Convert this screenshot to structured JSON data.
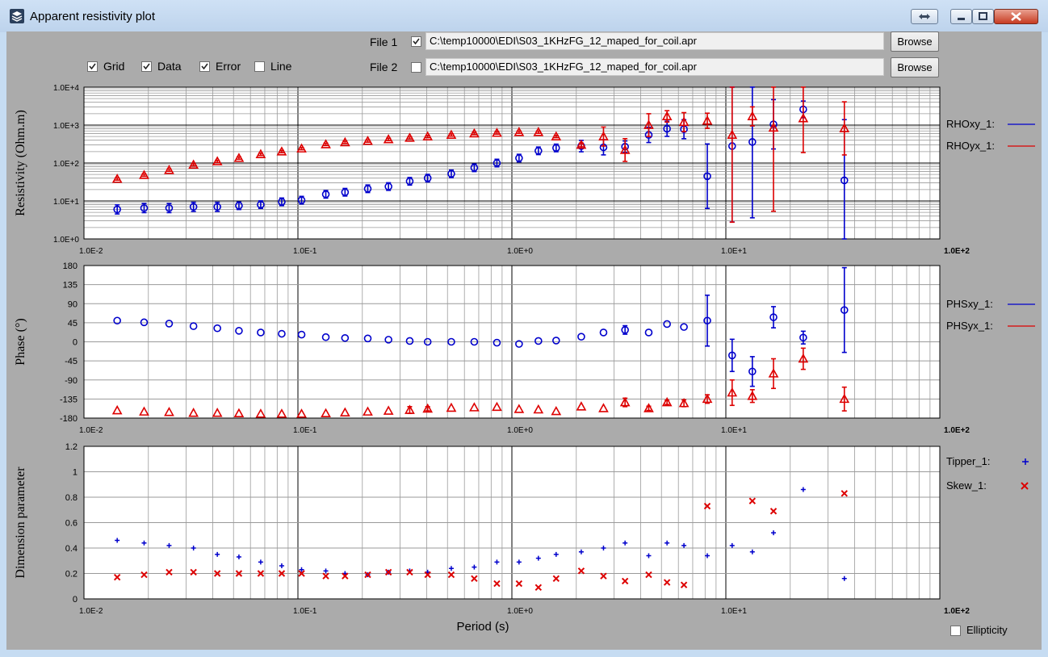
{
  "window": {
    "title": "Apparent resistivity plot",
    "icon": "layers-app-icon",
    "buttons": [
      "swap-icon",
      "minimize-icon",
      "maximize-icon",
      "close-icon"
    ]
  },
  "files": [
    {
      "label": "File 1",
      "checked": true,
      "path": "C:\\temp10000\\EDI\\S03_1KHzFG_12_maped_for_coil.apr",
      "browse": "Browse"
    },
    {
      "label": "File 2",
      "checked": false,
      "path": "C:\\temp10000\\EDI\\S03_1KHzFG_12_maped_for_coil.apr",
      "browse": "Browse"
    }
  ],
  "options": [
    {
      "label": "Grid",
      "checked": true
    },
    {
      "label": "Data",
      "checked": true
    },
    {
      "label": "Error",
      "checked": true
    },
    {
      "label": "Line",
      "checked": false
    }
  ],
  "ellipticity": {
    "label": "Ellipticity",
    "checked": false
  },
  "colors": {
    "blue": "#0000cc",
    "red": "#dd0000",
    "plot_bg": "#ffffff",
    "panel_bg": "#ababab",
    "grid": "#9a9a9a"
  },
  "chart_data": [
    {
      "type": "scatter",
      "ylabel": "Resistivity (Ohm.m)",
      "xlabel": "",
      "x_scale": "log",
      "y_scale": "log",
      "xlim": [
        0.01,
        100
      ],
      "ylim": [
        1,
        10000
      ],
      "xtick_labels": [
        "1.0E-2",
        "1.0E-1",
        "1.0E+0",
        "1.0E+1",
        "1.0E+2"
      ],
      "ytick_labels": [
        "1.0E+0",
        "1.0E+1",
        "1.0E+2",
        "1.0E+3",
        "1.0E+4"
      ],
      "grid": true,
      "legend_position": "right",
      "series": [
        {
          "name": "RHOxy_1:",
          "marker": "circle",
          "color": "#0000cc",
          "x": [
            0.0143,
            0.0191,
            0.025,
            0.0325,
            0.042,
            0.053,
            0.067,
            0.084,
            0.104,
            0.135,
            0.166,
            0.212,
            0.265,
            0.333,
            0.404,
            0.521,
            0.667,
            0.851,
            1.08,
            1.33,
            1.61,
            2.11,
            2.68,
            3.38,
            4.36,
            5.31,
            6.37,
            8.19,
            10.7,
            13.3,
            16.7,
            23.0,
            35.8
          ],
          "y": [
            6,
            6.5,
            6.5,
            7,
            7,
            7.5,
            8,
            9.5,
            10.5,
            15,
            17,
            21,
            24,
            33,
            40,
            52,
            75,
            100,
            135,
            210,
            250,
            280,
            260,
            270,
            550,
            800,
            780,
            45,
            280,
            360,
            1050,
            2600,
            35
          ],
          "err": [
            0.12,
            0.12,
            0.12,
            0.12,
            0.12,
            0.1,
            0.1,
            0.1,
            0.1,
            0.1,
            0.1,
            0.1,
            0.1,
            0.1,
            0.1,
            0.1,
            0.1,
            0.1,
            0.1,
            0.1,
            0.1,
            0.15,
            0.2,
            0.15,
            0.2,
            0.2,
            0.25,
            0.85,
            2.0,
            2.0,
            0.65,
            0.22,
            1.6
          ]
        },
        {
          "name": "RHOyx_1:",
          "marker": "triangle",
          "color": "#dd0000",
          "x": [
            0.0143,
            0.0191,
            0.025,
            0.0325,
            0.042,
            0.053,
            0.067,
            0.084,
            0.104,
            0.135,
            0.166,
            0.212,
            0.265,
            0.333,
            0.404,
            0.521,
            0.667,
            0.851,
            1.08,
            1.33,
            1.61,
            2.11,
            2.68,
            3.38,
            4.36,
            5.31,
            6.37,
            8.19,
            10.7,
            13.3,
            16.7,
            23.0,
            35.8
          ],
          "y": [
            38,
            48,
            65,
            90,
            110,
            135,
            170,
            200,
            240,
            310,
            350,
            380,
            420,
            460,
            500,
            550,
            600,
            620,
            650,
            650,
            500,
            300,
            500,
            220,
            1000,
            1700,
            1200,
            1300,
            550,
            1700,
            850,
            1500,
            820
          ],
          "err": [
            0.03,
            0.03,
            0.03,
            0.03,
            0.03,
            0.03,
            0.03,
            0.03,
            0.03,
            0.03,
            0.03,
            0.03,
            0.03,
            0.03,
            0.03,
            0.03,
            0.03,
            0.03,
            0.03,
            0.03,
            0.03,
            0.05,
            0.25,
            0.3,
            0.3,
            0.15,
            0.25,
            0.2,
            2.3,
            0.25,
            2.2,
            0.9,
            0.7
          ]
        }
      ]
    },
    {
      "type": "scatter",
      "ylabel": "Phase (°)",
      "xlabel": "",
      "x_scale": "log",
      "xlim": [
        0.01,
        100
      ],
      "ylim": [
        -180,
        180
      ],
      "xtick_labels": [
        "1.0E-2",
        "1.0E-1",
        "1.0E+0",
        "1.0E+1",
        "1.0E+2"
      ],
      "ytick_labels": [
        "180",
        "135",
        "90",
        "45",
        "0",
        "-45",
        "-90",
        "-135",
        "-180"
      ],
      "grid": true,
      "legend_position": "right",
      "series": [
        {
          "name": "PHSxy_1:",
          "marker": "circle",
          "color": "#0000cc",
          "x": [
            0.0143,
            0.0191,
            0.025,
            0.0325,
            0.042,
            0.053,
            0.067,
            0.084,
            0.104,
            0.135,
            0.166,
            0.212,
            0.265,
            0.333,
            0.404,
            0.521,
            0.667,
            0.851,
            1.08,
            1.33,
            1.61,
            2.11,
            2.68,
            3.38,
            4.36,
            5.31,
            6.37,
            8.19,
            10.7,
            13.3,
            16.7,
            23.0,
            35.8
          ],
          "y": [
            50,
            46,
            43,
            37,
            32,
            26,
            22,
            19,
            17,
            11,
            9,
            8,
            5,
            2,
            0,
            0,
            0,
            -2,
            -5,
            2,
            3,
            12,
            22,
            28,
            22,
            42,
            35,
            50,
            -32,
            -70,
            58,
            10,
            75
          ],
          "err": [
            0,
            0,
            0,
            0,
            0,
            0,
            0,
            0,
            0,
            0,
            0,
            0,
            0,
            0,
            0,
            0,
            0,
            0,
            0,
            0,
            0,
            0,
            0,
            10,
            0,
            0,
            0,
            60,
            38,
            35,
            25,
            15,
            100
          ]
        },
        {
          "name": "PHSyx_1:",
          "marker": "triangle",
          "color": "#dd0000",
          "x": [
            0.0143,
            0.0191,
            0.025,
            0.0325,
            0.042,
            0.053,
            0.067,
            0.084,
            0.104,
            0.135,
            0.166,
            0.212,
            0.265,
            0.333,
            0.404,
            0.521,
            0.667,
            0.851,
            1.08,
            1.33,
            1.61,
            2.11,
            2.68,
            3.38,
            4.36,
            5.31,
            6.37,
            8.19,
            10.7,
            13.3,
            16.7,
            23.0,
            35.8
          ],
          "y": [
            -162,
            -165,
            -166,
            -168,
            -168,
            -169,
            -170,
            -170,
            -170,
            -169,
            -167,
            -165,
            -163,
            -161,
            -158,
            -156,
            -155,
            -154,
            -159,
            -160,
            -164,
            -153,
            -157,
            -143,
            -157,
            -143,
            -145,
            -135,
            -120,
            -128,
            -75,
            -40,
            -135
          ],
          "err": [
            0,
            0,
            0,
            0,
            0,
            0,
            0,
            0,
            0,
            0,
            0,
            0,
            0,
            8,
            5,
            0,
            0,
            0,
            0,
            0,
            0,
            0,
            0,
            10,
            5,
            5,
            8,
            10,
            30,
            15,
            35,
            25,
            28
          ]
        }
      ]
    },
    {
      "type": "scatter",
      "ylabel": "Dimension parameter",
      "xlabel": "Period (s)",
      "x_scale": "log",
      "xlim": [
        0.01,
        100
      ],
      "ylim": [
        0,
        1.2
      ],
      "xtick_labels": [
        "1.0E-2",
        "1.0E-1",
        "1.0E+0",
        "1.0E+1",
        "1.0E+2"
      ],
      "ytick_labels": [
        "1.2",
        "1",
        "0.8",
        "0.6",
        "0.4",
        "0.2",
        "0"
      ],
      "grid": true,
      "legend_position": "right",
      "series": [
        {
          "name": "Tipper_1:",
          "marker": "plus",
          "color": "#0000cc",
          "x": [
            0.0143,
            0.0191,
            0.025,
            0.0325,
            0.042,
            0.053,
            0.067,
            0.084,
            0.104,
            0.135,
            0.166,
            0.212,
            0.265,
            0.333,
            0.404,
            0.521,
            0.667,
            0.851,
            1.08,
            1.33,
            1.61,
            2.11,
            2.68,
            3.38,
            4.36,
            5.31,
            6.37,
            8.19,
            10.7,
            13.3,
            16.7,
            23.0,
            35.8
          ],
          "y": [
            0.46,
            0.44,
            0.42,
            0.4,
            0.35,
            0.33,
            0.29,
            0.26,
            0.23,
            0.22,
            0.2,
            0.19,
            0.21,
            0.22,
            0.21,
            0.24,
            0.25,
            0.29,
            0.29,
            0.32,
            0.35,
            0.37,
            0.4,
            0.44,
            0.34,
            0.44,
            0.42,
            0.34,
            0.42,
            0.37,
            0.52,
            0.86,
            0.16
          ]
        },
        {
          "name": "Skew_1:",
          "marker": "x",
          "color": "#dd0000",
          "x": [
            0.0143,
            0.0191,
            0.025,
            0.0325,
            0.042,
            0.053,
            0.067,
            0.084,
            0.104,
            0.135,
            0.166,
            0.212,
            0.265,
            0.333,
            0.404,
            0.521,
            0.667,
            0.851,
            1.08,
            1.33,
            1.61,
            2.11,
            2.68,
            3.38,
            4.36,
            5.31,
            6.37,
            8.19,
            10.7,
            13.3,
            16.7,
            23.0,
            35.8
          ],
          "y": [
            0.17,
            0.19,
            0.21,
            0.21,
            0.2,
            0.2,
            0.2,
            0.2,
            0.2,
            0.18,
            0.18,
            0.19,
            0.21,
            0.21,
            0.19,
            0.19,
            0.16,
            0.12,
            0.12,
            0.09,
            0.16,
            0.22,
            0.18,
            0.14,
            0.19,
            0.13,
            0.11,
            0.73,
            null,
            0.77,
            0.69,
            null,
            0.83
          ]
        }
      ]
    }
  ]
}
